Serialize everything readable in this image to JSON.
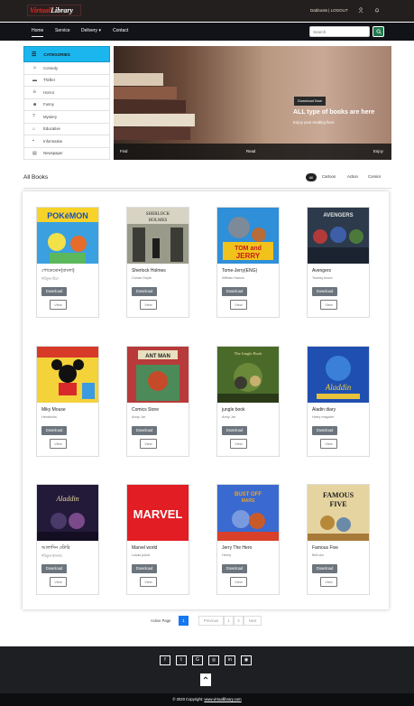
{
  "header": {
    "logo_part1": "Virtual",
    "logo_part2": "Library",
    "user_links": "Dabbosts | LOGOUT",
    "icons": [
      "user-icon",
      "bell-icon"
    ]
  },
  "nav": {
    "items": [
      {
        "label": "Home",
        "active": true
      },
      {
        "label": "Service"
      },
      {
        "label": "Delivery ▾"
      },
      {
        "label": "Contact"
      }
    ],
    "search_placeholder": "Search",
    "search_icon": "search-icon"
  },
  "categories": {
    "title": "CATEGORIES",
    "items": [
      {
        "label": "Comedy",
        "icon": "laugh-icon"
      },
      {
        "label": "Thriller",
        "icon": "film-icon"
      },
      {
        "label": "Horror",
        "icon": "skull-icon"
      },
      {
        "label": "Funny",
        "icon": "smile-icon"
      },
      {
        "label": "Mystery",
        "icon": "question-icon"
      },
      {
        "label": "Educative",
        "icon": "graduation-icon"
      },
      {
        "label": "Informative",
        "icon": "info-icon"
      },
      {
        "label": "Newspaper",
        "icon": "newspaper-icon"
      }
    ]
  },
  "hero": {
    "button": "Download Now",
    "title": "ALL type of books are here",
    "subtitle": "Enjoy your reading here",
    "bar": [
      "Find",
      "Read",
      "Enjoy"
    ]
  },
  "books_section": {
    "title": "All Books",
    "filters": [
      "All",
      "Cartoon",
      "Action",
      "Comics"
    ]
  },
  "books": [
    {
      "title": "পোকেমোন(বাংলা)",
      "author": "শরিফুল মিয়া",
      "cover": "pokemon"
    },
    {
      "title": "Sherlock Holmes",
      "author": "Conan Doyle",
      "cover": "sherlock"
    },
    {
      "title": "Tome-Jerry(ENG)",
      "author": "William Hanna",
      "cover": "tomjerry"
    },
    {
      "title": "Avengers",
      "author": "Tooney knoor",
      "cover": "avengers"
    },
    {
      "title": "Miky Mouse",
      "author": "Hendricks",
      "cover": "mickey"
    },
    {
      "title": "Comics Store",
      "author": "Anny Jar",
      "cover": "comics"
    },
    {
      "title": "jungle book",
      "author": "Anny Jar",
      "cover": "jungle"
    },
    {
      "title": "Aladin diary",
      "author": "Harry maguire",
      "cover": "aladdin"
    },
    {
      "title": "আলাদিন স্টোরি",
      "author": "শরিফুল ইসলাম",
      "cover": "aladdin2"
    },
    {
      "title": "Marvel world",
      "author": "Lukas polok",
      "cover": "marvel"
    },
    {
      "title": "Jerry The Hero",
      "author": "Henry",
      "cover": "bustedmars"
    },
    {
      "title": "Famous Five",
      "author": "Bell dor",
      "cover": "famousfive"
    }
  ],
  "book_actions": {
    "download": "Download",
    "view": "View"
  },
  "pagination": {
    "label": "Active Page",
    "current": "1",
    "previous": "Previous",
    "pages": [
      "1",
      "2"
    ],
    "next": "Next"
  },
  "footer": {
    "social_icons": [
      "facebook-icon",
      "twitter-icon",
      "google-icon",
      "instagram-icon",
      "linkedin-icon",
      "github-icon"
    ],
    "social_glyphs": [
      "f",
      "t",
      "G",
      "◎",
      "in",
      "◉"
    ],
    "top_icon": "chevron-up-icon",
    "copyright_prefix": "© 2020 Copyright:",
    "copyright_link": "www.virtuallibrary.com"
  }
}
